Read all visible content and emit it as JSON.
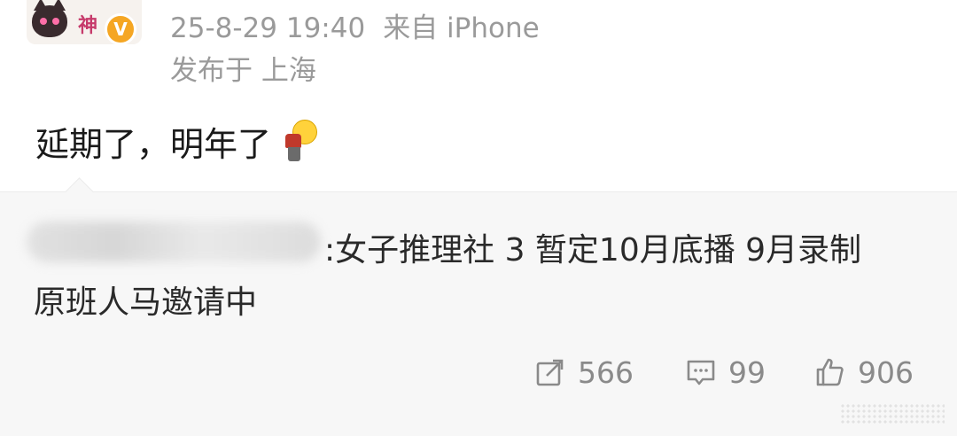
{
  "header": {
    "avatar_text": "神",
    "verified_badge": "V",
    "timestamp": "25-8-29 19:40",
    "source": "来自 iPhone",
    "location": "发布于 上海"
  },
  "post": {
    "text": "延期了，明年了",
    "emoji": "bowing-person-emoji"
  },
  "repost": {
    "line1": ":女子推理社 3 暂定10月底播 9月录制",
    "line2": "原班人马邀请中"
  },
  "actions": {
    "repost_count": "566",
    "comment_count": "99",
    "like_count": "906",
    "repost_icon": "share-icon",
    "comment_icon": "comment-icon",
    "like_icon": "thumbs-up-icon"
  },
  "colors": {
    "meta_gray": "#9a9a9a",
    "card_bg": "#f7f7f7",
    "verified_orange": "#f5a623"
  }
}
